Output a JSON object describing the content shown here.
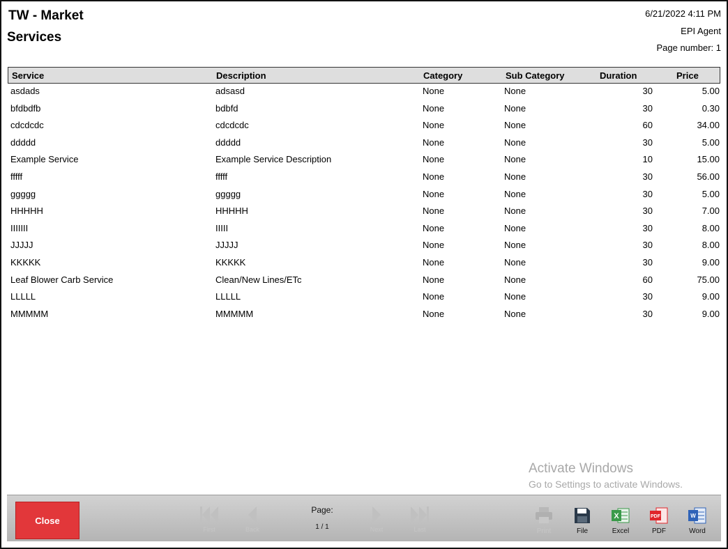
{
  "report": {
    "title_line1": "TW - Market",
    "title_line2": "Services",
    "datetime": "6/21/2022 4:11 PM",
    "agent": "EPI Agent",
    "page_number_label": "Page number:",
    "page_number": "1"
  },
  "table": {
    "headers": {
      "service": "Service",
      "description": "Description",
      "category": "Category",
      "sub_category": "Sub Category",
      "duration": "Duration",
      "price": "Price"
    },
    "rows": [
      {
        "service": "asdads",
        "description": "adsasd",
        "category": "None",
        "sub_category": "None",
        "duration": "30",
        "price": "5.00"
      },
      {
        "service": "bfdbdfb",
        "description": "bdbfd",
        "category": "None",
        "sub_category": "None",
        "duration": "30",
        "price": "0.30"
      },
      {
        "service": "cdcdcdc",
        "description": "cdcdcdc",
        "category": "None",
        "sub_category": "None",
        "duration": "60",
        "price": "34.00"
      },
      {
        "service": "ddddd",
        "description": "ddddd",
        "category": "None",
        "sub_category": "None",
        "duration": "30",
        "price": "5.00"
      },
      {
        "service": "Example Service",
        "description": "Example Service Description",
        "category": "None",
        "sub_category": "None",
        "duration": "10",
        "price": "15.00"
      },
      {
        "service": "fffff",
        "description": "fffff",
        "category": "None",
        "sub_category": "None",
        "duration": "30",
        "price": "56.00"
      },
      {
        "service": "ggggg",
        "description": "ggggg",
        "category": "None",
        "sub_category": "None",
        "duration": "30",
        "price": "5.00"
      },
      {
        "service": "HHHHH",
        "description": "HHHHH",
        "category": "None",
        "sub_category": "None",
        "duration": "30",
        "price": "7.00"
      },
      {
        "service": "IIIIIII",
        "description": "IIIII",
        "category": "None",
        "sub_category": "None",
        "duration": "30",
        "price": "8.00"
      },
      {
        "service": "JJJJJ",
        "description": "JJJJJ",
        "category": "None",
        "sub_category": "None",
        "duration": "30",
        "price": "8.00"
      },
      {
        "service": "KKKKK",
        "description": "KKKKK",
        "category": "None",
        "sub_category": "None",
        "duration": "30",
        "price": "9.00"
      },
      {
        "service": "Leaf Blower Carb Service",
        "description": "Clean/New Lines/ETc",
        "category": "None",
        "sub_category": "None",
        "duration": "60",
        "price": "75.00"
      },
      {
        "service": "LLLLL",
        "description": "LLLLL",
        "category": "None",
        "sub_category": "None",
        "duration": "30",
        "price": "9.00"
      },
      {
        "service": "MMMMM",
        "description": "MMMMM",
        "category": "None",
        "sub_category": "None",
        "duration": "30",
        "price": "9.00"
      }
    ]
  },
  "watermark": {
    "line1": "Activate Windows",
    "line2": "Go to Settings to activate Windows."
  },
  "toolbar": {
    "close_label": "Close",
    "first_label": "First",
    "back_label": "Back",
    "page_label": "Page:",
    "page_value": "1 / 1",
    "next_label": "Next",
    "last_label": "Last",
    "print_label": "Print",
    "file_label": "File",
    "excel_label": "Excel",
    "pdf_label": "PDF",
    "word_label": "Word",
    "close_color": "#e2373a",
    "excel_color": "#3a9a4a",
    "pdf_color": "#e0262b",
    "word_color": "#2f63b8",
    "file_color": "#2b3a4a"
  }
}
